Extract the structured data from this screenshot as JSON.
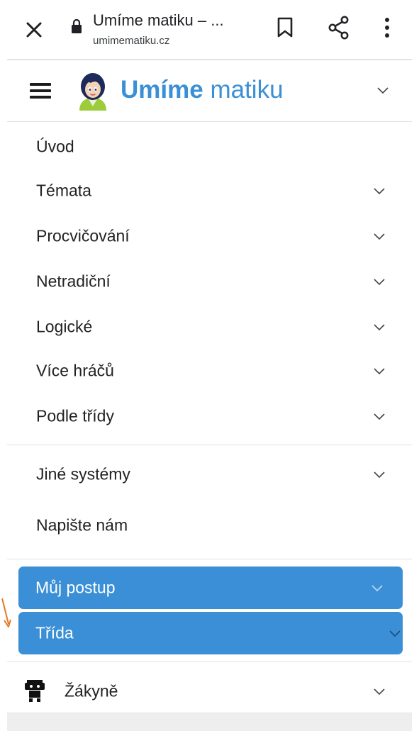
{
  "browser": {
    "title": "Umíme matiku – ...",
    "url": "umimematiku.cz",
    "icons": {
      "close": "close-icon",
      "lock": "lock-icon",
      "bookmark": "bookmark-icon",
      "share": "share-icon",
      "more": "more-vert-icon"
    }
  },
  "site": {
    "logo_bold": "Umíme",
    "logo_light": "matiku",
    "brand_color": "#3a8fd6"
  },
  "nav": {
    "items": [
      {
        "label": "Úvod"
      },
      {
        "label": "Témata"
      },
      {
        "label": "Procvičování"
      },
      {
        "label": "Netradiční"
      },
      {
        "label": "Logické"
      },
      {
        "label": "Více hráčů"
      },
      {
        "label": "Podle třídy"
      }
    ],
    "secondary": [
      {
        "label": "Jiné systémy"
      },
      {
        "label": "Napište nám"
      }
    ]
  },
  "account": {
    "progress_label": "Můj postup",
    "class_label": "Třída",
    "user_label": "Žákyně"
  }
}
